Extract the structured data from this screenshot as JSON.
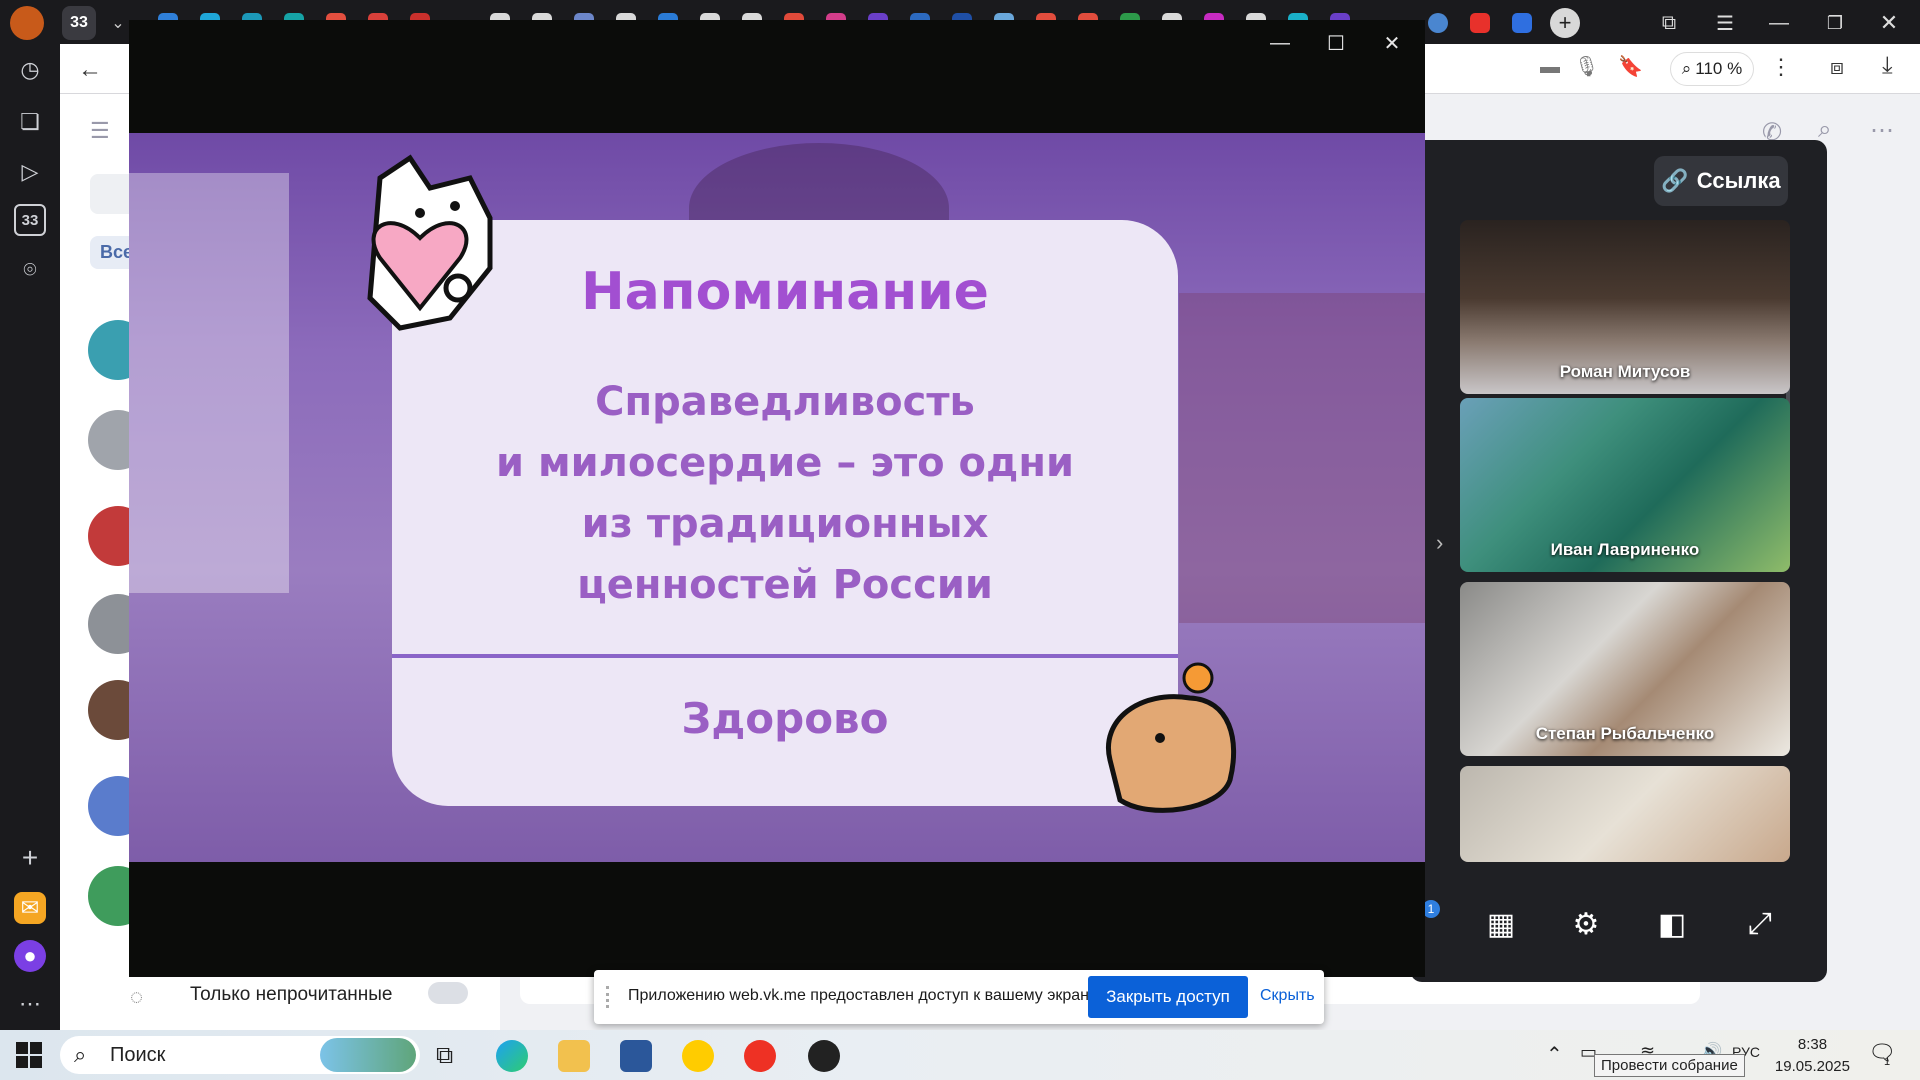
{
  "colors": {
    "accent": "#0b61d8",
    "slide_title": "#a24fd1",
    "slide_text": "#9a5fc4",
    "slide_card": "#ede7f6"
  },
  "browser": {
    "tab_count": "33",
    "zoom": "110 %"
  },
  "sidebar_left": {
    "tab_count_badge": "33"
  },
  "chat_list": {
    "filter_label": "Все",
    "unread_only_label": "Только непрочитанные"
  },
  "call_panel": {
    "link_button": "Ссылка",
    "participants": [
      {
        "name": "Роман Митусов"
      },
      {
        "name": "Иван Лавриненко"
      },
      {
        "name": "Степан Рыбальченко"
      },
      {
        "name": ""
      }
    ],
    "badge_count": "1"
  },
  "slide": {
    "title": "Напоминание",
    "body_lines": [
      "Справедливость",
      "и милосердие – это одни",
      "из традиционных",
      "ценностей России"
    ],
    "footer": "Здорово"
  },
  "share_bar": {
    "message": "Приложению web.vk.me предоставлен доступ к вашему экрану.",
    "stop_button": "Закрыть доступ",
    "hide_link": "Скрыть"
  },
  "taskbar": {
    "search_label": "Поиск",
    "lang": "РУС",
    "time": "8:38",
    "date": "19.05.2025",
    "notification_count": "1",
    "tooltip": "Провести собрание"
  }
}
